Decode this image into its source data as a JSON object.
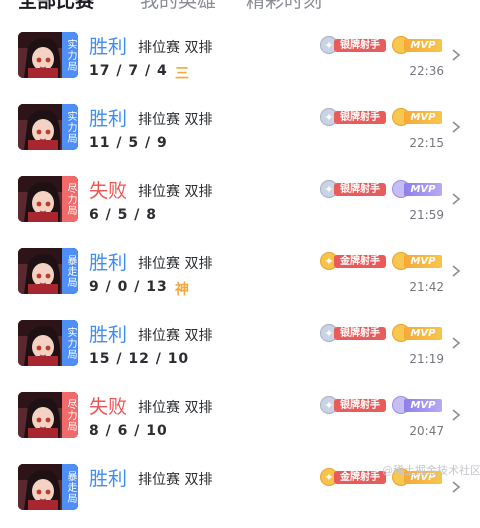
{
  "tabs": [
    {
      "label": "全部比赛",
      "active": true
    },
    {
      "label": "我的英雄",
      "active": false
    },
    {
      "label": "精彩时刻",
      "active": false
    }
  ],
  "icons": {
    "tab_dropdown": "chevron-down-icon",
    "filter": "filter-icon",
    "row_arrow": "chevron-right-icon"
  },
  "colors": {
    "win": "#3d8df5",
    "lose": "#f05454",
    "badge": "#f2a93b"
  },
  "matches": [
    {
      "tag": "实力局",
      "tag_color": "blue",
      "result": "胜利",
      "outcome": "win",
      "mode": "排位赛 双排",
      "kda": "17 / 7 / 4",
      "kda_badge": "三",
      "medal": "银牌射手",
      "medal_tier": "silver",
      "mvp": "MVP",
      "mvp_tier": "gold",
      "time": "22:36"
    },
    {
      "tag": "实力局",
      "tag_color": "blue",
      "result": "胜利",
      "outcome": "win",
      "mode": "排位赛 双排",
      "kda": "11 / 5 / 9",
      "kda_badge": "",
      "medal": "银牌射手",
      "medal_tier": "silver",
      "mvp": "MVP",
      "mvp_tier": "gold",
      "time": "22:15"
    },
    {
      "tag": "尽力局",
      "tag_color": "red",
      "result": "失败",
      "outcome": "lose",
      "mode": "排位赛 双排",
      "kda": "6 / 5 / 8",
      "kda_badge": "",
      "medal": "银牌射手",
      "medal_tier": "silver",
      "mvp": "MVP",
      "mvp_tier": "purple",
      "time": "21:59"
    },
    {
      "tag": "暴走局",
      "tag_color": "blue",
      "result": "胜利",
      "outcome": "win",
      "mode": "排位赛 双排",
      "kda": "9 / 0 / 13",
      "kda_badge": "神",
      "medal": "金牌射手",
      "medal_tier": "gold",
      "mvp": "MVP",
      "mvp_tier": "gold",
      "time": "21:42"
    },
    {
      "tag": "实力局",
      "tag_color": "blue",
      "result": "胜利",
      "outcome": "win",
      "mode": "排位赛 双排",
      "kda": "15 / 12 / 10",
      "kda_badge": "",
      "medal": "银牌射手",
      "medal_tier": "silver",
      "mvp": "MVP",
      "mvp_tier": "gold",
      "time": "21:19"
    },
    {
      "tag": "尽力局",
      "tag_color": "red",
      "result": "失败",
      "outcome": "lose",
      "mode": "排位赛 双排",
      "kda": "8 / 6 / 10",
      "kda_badge": "",
      "medal": "银牌射手",
      "medal_tier": "silver",
      "mvp": "MVP",
      "mvp_tier": "purple",
      "time": "20:47"
    },
    {
      "tag": "暴走局",
      "tag_color": "blue",
      "result": "胜利",
      "outcome": "win",
      "mode": "排位赛 双排",
      "kda": "",
      "kda_badge": "",
      "medal": "金牌射手",
      "medal_tier": "gold",
      "mvp": "MVP",
      "mvp_tier": "gold",
      "time": ""
    }
  ],
  "watermark": "@稀土掘金技术社区"
}
